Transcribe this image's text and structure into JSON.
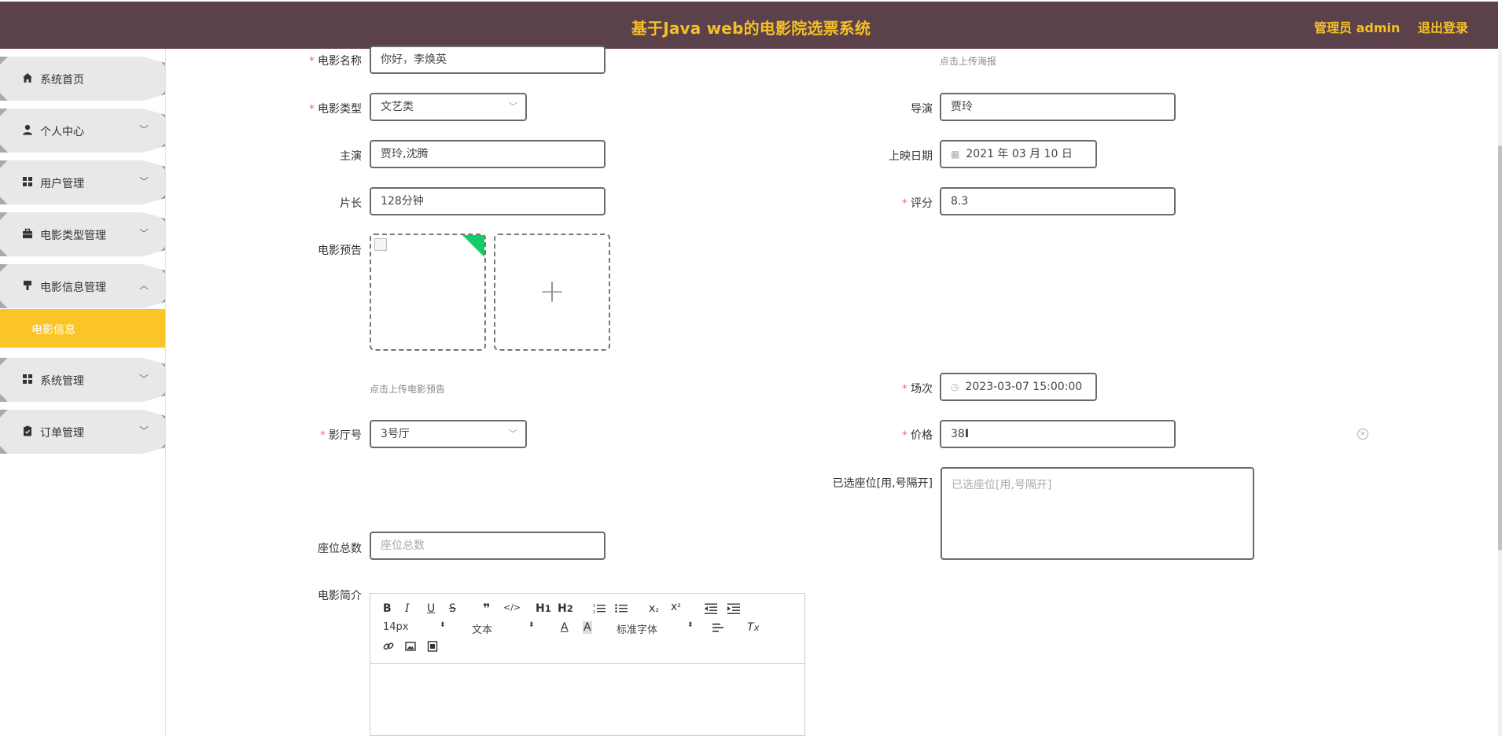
{
  "header": {
    "title": "基于Java web的电影院选票系统",
    "admin": "管理员 admin",
    "logout": "退出登录"
  },
  "sidebar": {
    "items": [
      {
        "label": "系统首页",
        "icon": "home-icon"
      },
      {
        "label": "个人中心",
        "icon": "user-icon"
      },
      {
        "label": "用户管理",
        "icon": "grid-icon"
      },
      {
        "label": "电影类型管理",
        "icon": "briefcase-icon"
      },
      {
        "label": "电影信息管理",
        "icon": "brush-icon",
        "expanded": true
      },
      {
        "label": "系统管理",
        "icon": "grid-icon"
      },
      {
        "label": "订单管理",
        "icon": "clipboard-icon"
      }
    ],
    "active_sub": "电影信息",
    "active_color": "#fbc527"
  },
  "form": {
    "name": {
      "label": "电影名称",
      "value": "你好，李焕英"
    },
    "poster_hint": "点击上传海报",
    "type": {
      "label": "电影类型",
      "value": "文艺类"
    },
    "director": {
      "label": "导演",
      "value": "贾玲"
    },
    "actors": {
      "label": "主演",
      "value": "贾玲,沈腾"
    },
    "release_date": {
      "label": "上映日期",
      "value": "2021 年 03 月 10 日"
    },
    "duration": {
      "label": "片长",
      "value": "128分钟"
    },
    "rating": {
      "label": "评分",
      "value": "8.3"
    },
    "preview": {
      "label": "电影预告",
      "hint": "点击上传电影预告"
    },
    "session": {
      "label": "场次",
      "value": "2023-03-07 15:00:00"
    },
    "hall": {
      "label": "影厅号",
      "value": "3号厅"
    },
    "price": {
      "label": "价格",
      "value": "38"
    },
    "selected_seats": {
      "label": "已选座位[用,号隔开]",
      "placeholder": "已选座位[用,号隔开]"
    },
    "total_seats": {
      "label": "座位总数",
      "placeholder": "座位总数"
    },
    "intro": {
      "label": "电影简介"
    }
  },
  "editor": {
    "font_size": "14px",
    "format": "文本",
    "font_family": "标准字体",
    "buttons": [
      "B",
      "I",
      "U",
      "S",
      "❞",
      "</>",
      "H1",
      "H2",
      "ordered-list",
      "bullet-list",
      "x₂",
      "x²",
      "outdent",
      "indent",
      "A",
      "A-bg",
      "align",
      "Tx",
      "link",
      "image",
      "video"
    ]
  },
  "colors": {
    "header_bg": "#5b4149",
    "header_text": "#f4c02a",
    "required": "#f56c6c"
  }
}
